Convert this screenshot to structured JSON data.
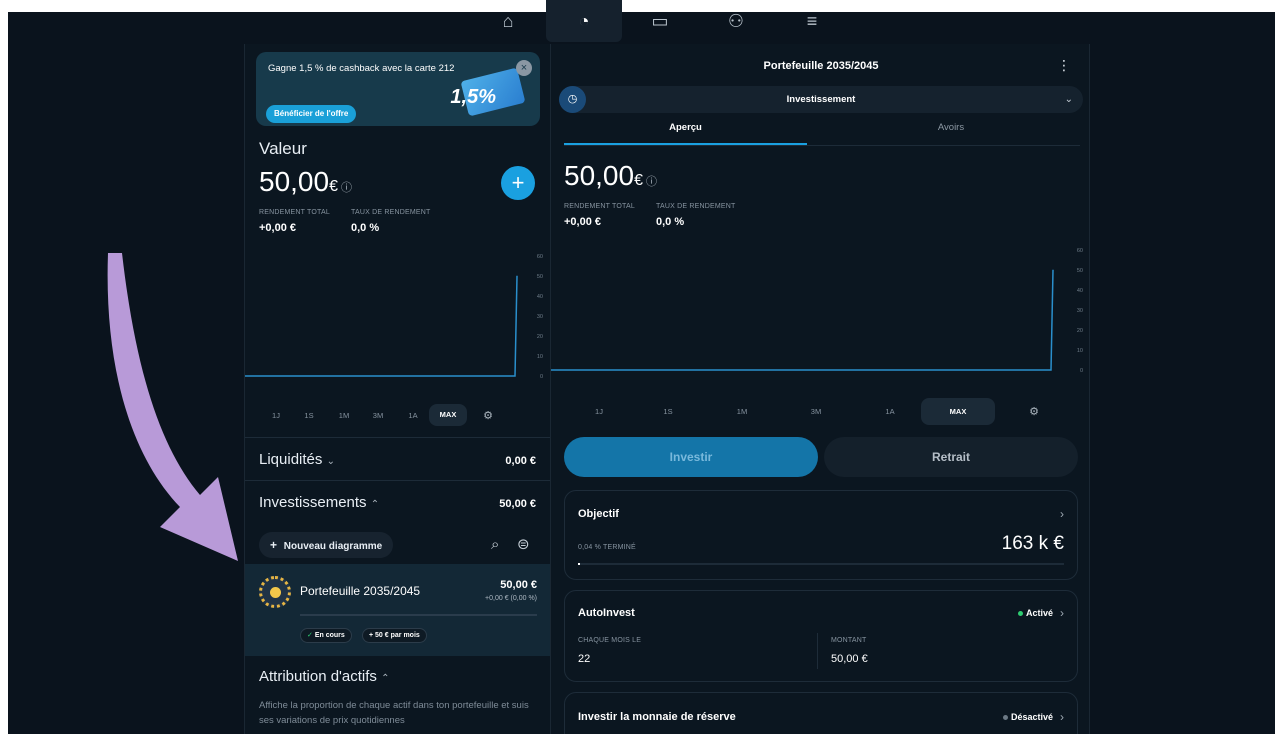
{
  "colors": {
    "accent": "#1aa0e0",
    "background": "#0a131d",
    "arrow": "#b89ad8",
    "active_dot": "#2ecc71"
  },
  "nav": {
    "icons": [
      "home-icon",
      "pie-chart-icon",
      "card-icon",
      "people-icon",
      "menu-icon"
    ],
    "active": "pie-chart-icon"
  },
  "promo": {
    "text": "Gagne 1,5 % de cashback avec la carte 212",
    "button": "Bénéficier de l'offre",
    "card_text": "1,5%"
  },
  "left": {
    "value_title": "Valeur",
    "amount_main": "50,00",
    "amount_currency": "€",
    "kpi_total_label": "RENDEMENT TOTAL",
    "kpi_total_value": "+0,00 €",
    "kpi_rate_label": "TAUX DE RENDEMENT",
    "kpi_rate_value": "0,0 %",
    "yticks": [
      "60",
      "50",
      "40",
      "30",
      "20",
      "10",
      "0"
    ],
    "ranges": [
      "1J",
      "1S",
      "1M",
      "3M",
      "1A",
      "MAX"
    ],
    "liquidites_label": "Liquidités",
    "liquidites_value": "0,00 €",
    "investissements_label": "Investissements",
    "investissements_value": "50,00 €",
    "new_diagram": "Nouveau diagramme",
    "portfolio": {
      "name": "Portefeuille 2035/2045",
      "value": "50,00 €",
      "sub": "+0,00 € (0,00 %)",
      "pill_status": "En cours",
      "pill_plan": "+ 50 € par mois"
    },
    "attribution_title": "Attribution d'actifs",
    "attribution_desc": "Affiche la proportion de chaque actif dans ton portefeuille et suis ses variations de prix quotidiennes"
  },
  "right": {
    "title": "Portefeuille 2035/2045",
    "dropdown": "Investissement",
    "tab_overview": "Aperçu",
    "tab_holdings": "Avoirs",
    "amount_main": "50,00",
    "amount_currency": "€",
    "kpi_total_label": "RENDEMENT TOTAL",
    "kpi_total_value": "+0,00 €",
    "kpi_rate_label": "TAUX DE RENDEMENT",
    "kpi_rate_value": "0,0 %",
    "yticks": [
      "60",
      "50",
      "40",
      "30",
      "20",
      "10",
      "0"
    ],
    "ranges": [
      "1J",
      "1S",
      "1M",
      "3M",
      "1A",
      "MAX"
    ],
    "btn_invest": "Investir",
    "btn_withdraw": "Retrait",
    "objective": {
      "title": "Objectif",
      "progress_label": "0,04 % TERMINÉ",
      "target": "163 k €"
    },
    "autoinvest": {
      "title": "AutoInvest",
      "status": "Activé",
      "day_label": "CHAQUE MOIS LE",
      "day_value": "22",
      "amount_label": "MONTANT",
      "amount_value": "50,00 €"
    },
    "roundup": {
      "title": "Investir la monnaie de réserve",
      "status": "Désactivé"
    }
  },
  "chart_data": [
    {
      "type": "line",
      "title": "",
      "ylim": [
        0,
        60
      ],
      "ytick_labels": [
        "60",
        "50",
        "40",
        "30",
        "20",
        "10",
        "0"
      ],
      "series": [
        {
          "values": [
            0,
            0,
            0,
            0,
            0,
            50
          ]
        }
      ]
    },
    {
      "type": "line",
      "title": "",
      "ylim": [
        0,
        60
      ],
      "ytick_labels": [
        "60",
        "50",
        "40",
        "30",
        "20",
        "10",
        "0"
      ],
      "series": [
        {
          "values": [
            0,
            0,
            0,
            0,
            0,
            50
          ]
        }
      ]
    }
  ]
}
